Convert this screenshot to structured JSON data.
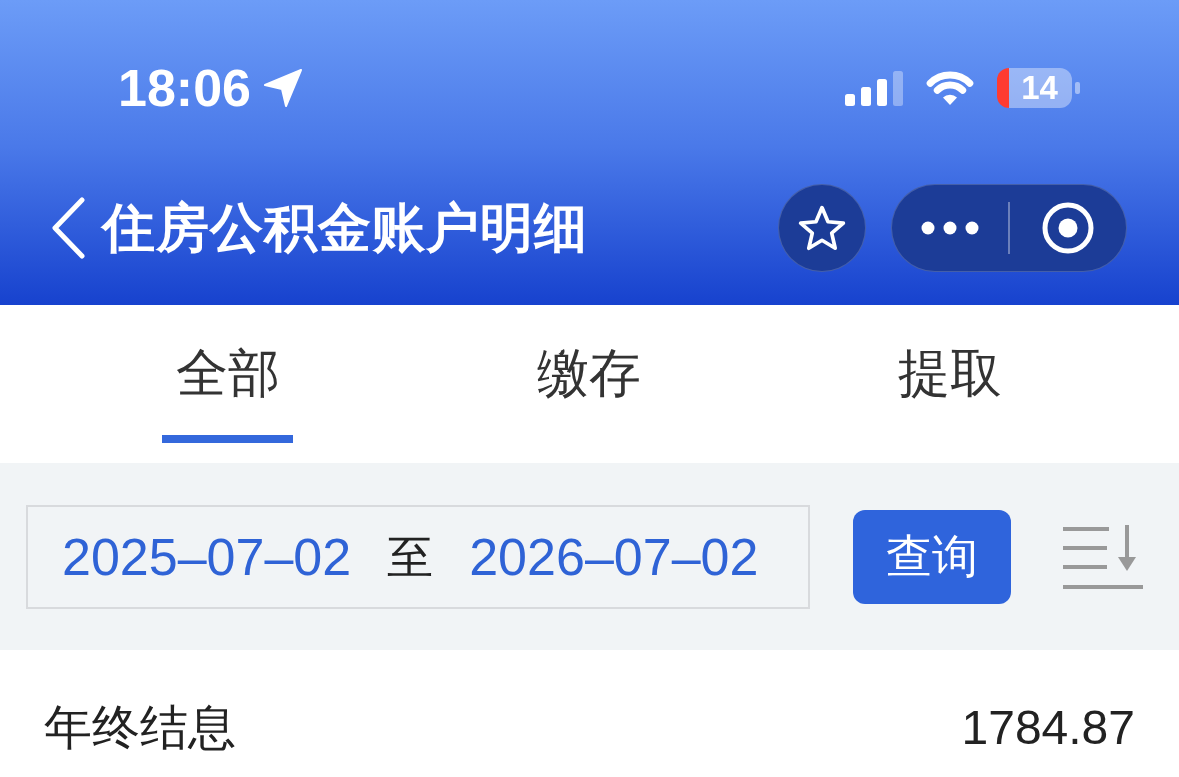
{
  "status_bar": {
    "time": "18:06",
    "battery": "14"
  },
  "nav_bar": {
    "title": "住房公积金账户明细"
  },
  "tabs": [
    {
      "label": "全部",
      "selected": true
    },
    {
      "label": "缴存",
      "selected": false
    },
    {
      "label": "提取",
      "selected": false
    }
  ],
  "date_filter": {
    "start_date": "2025–07–02",
    "separator": "至",
    "end_date": "2026–07–02",
    "query_button": "查询"
  },
  "records": [
    {
      "title": "年终结息",
      "amount": "1784.87"
    }
  ]
}
